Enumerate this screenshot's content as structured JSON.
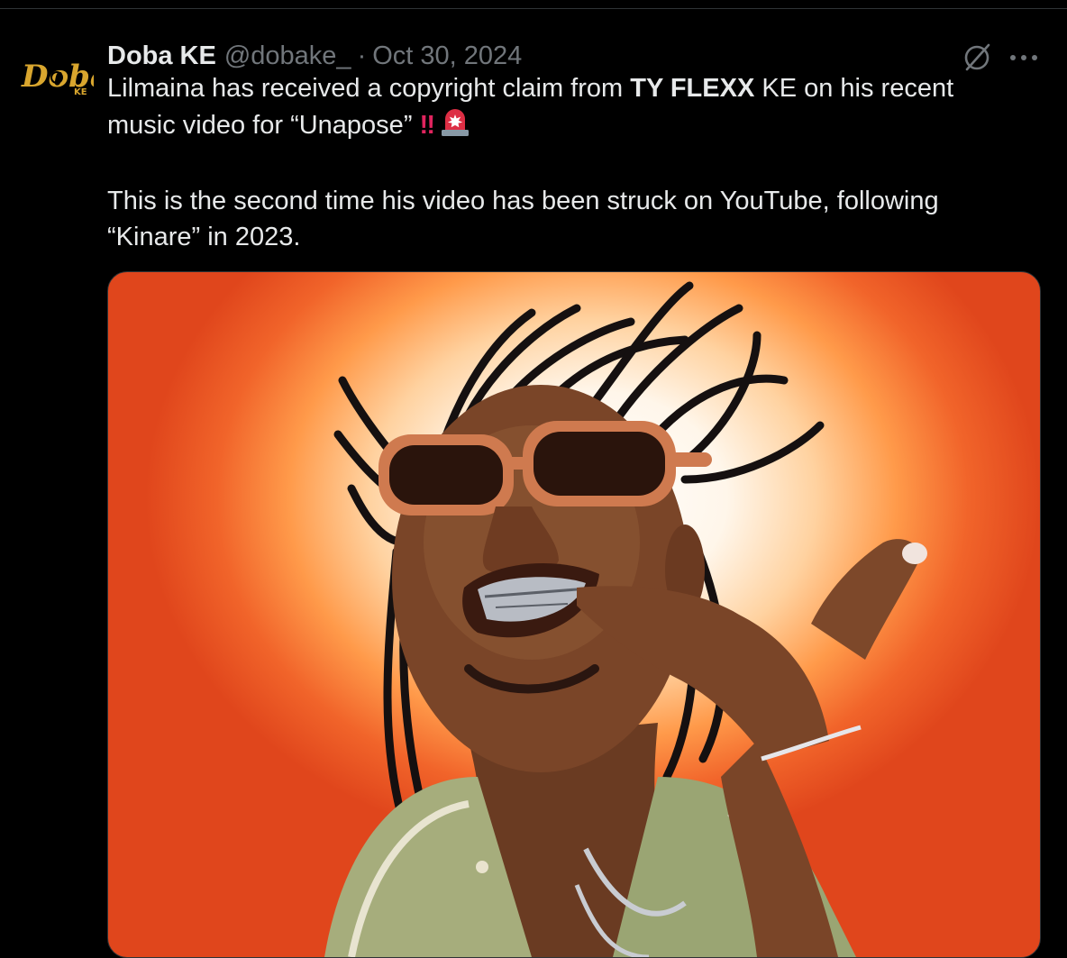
{
  "tweet": {
    "author": {
      "display_name": "Doba KE",
      "handle": "@dobake_",
      "avatar_logo": "Doba",
      "avatar_sub": "KE"
    },
    "separator": "·",
    "date": "Oct 30, 2024",
    "text": {
      "p1_before": "Lilmaina has received a copyright claim from ",
      "p1_mention": "TY FLEXX",
      "p1_after": " KE on his recent music video for “Unapose” ",
      "p1_emoji_bang": "‼",
      "p2": "This is the second time his video has been struck on YouTube, following “Kinare” in 2023."
    },
    "icons": {
      "grok": "grok-icon",
      "more": "more-icon",
      "siren": "siren-emoji"
    },
    "media": {
      "type": "photo"
    }
  },
  "colors": {
    "background": "#000000",
    "primary_text": "#e7e9ea",
    "secondary_text": "#71767b",
    "divider": "#2f3336",
    "logo_gold": "#d9a62e"
  }
}
